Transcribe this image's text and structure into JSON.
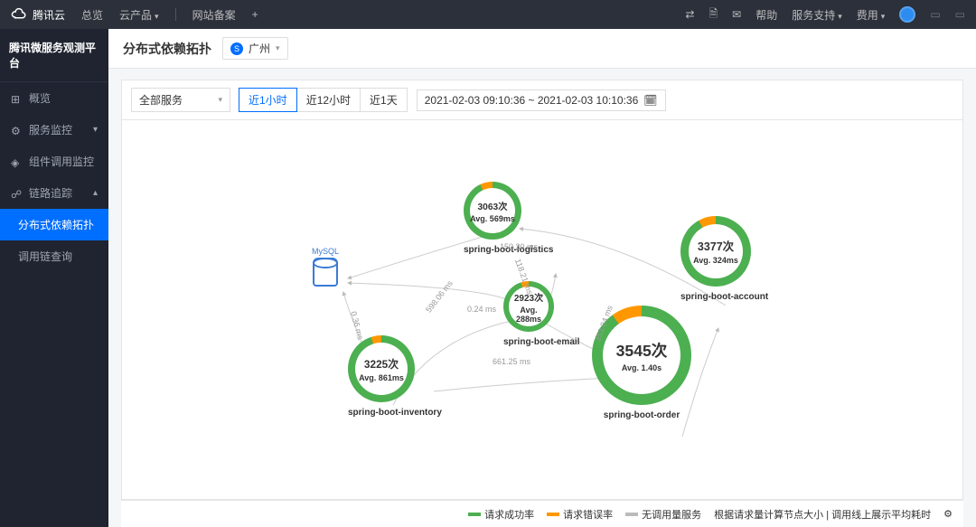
{
  "topbar": {
    "brand": "腾讯云",
    "nav": {
      "overview": "总览",
      "products": "云产品",
      "beian": "网站备案",
      "plus": "+"
    },
    "right": {
      "help": "帮助",
      "support": "服务支持",
      "fee": "费用"
    }
  },
  "sidebar": {
    "title": "腾讯微服务观测平台",
    "overview": "概览",
    "monitor": "服务监控",
    "component": "组件调用监控",
    "trace": "链路追踪",
    "topology": "分布式依赖拓扑",
    "chain": "调用链查询"
  },
  "page": {
    "title": "分布式依赖拓扑",
    "region": "广州"
  },
  "toolbar": {
    "service_filter": "全部服务",
    "range_1h": "近1小时",
    "range_12h": "近12小时",
    "range_1d": "近1天",
    "datetime": "2021-02-03 09:10:36 ~ 2021-02-03 10:10:36"
  },
  "nodes": {
    "mysql": {
      "label": "MySQL"
    },
    "logistics": {
      "count": "3063次",
      "avg": "Avg. 569ms",
      "label": "spring-boot-logistics",
      "size": 64,
      "success": 0.93
    },
    "email": {
      "count": "2923次",
      "avg": "Avg. 288ms",
      "label": "spring-boot-email",
      "size": 56,
      "success": 0.95
    },
    "account": {
      "count": "3377次",
      "avg": "Avg. 324ms",
      "label": "spring-boot-account",
      "size": 78,
      "success": 0.92
    },
    "inventory": {
      "count": "3225次",
      "avg": "Avg. 861ms",
      "label": "spring-boot-inventory",
      "size": 74,
      "success": 0.95
    },
    "order": {
      "count": "3545次",
      "avg": "Avg. 1.40s",
      "label": "spring-boot-order",
      "size": 110,
      "success": 0.9
    }
  },
  "edges": {
    "e1": "150.30 ms",
    "e2": "118.21 ms",
    "e3": "0.24 ms",
    "e4": "598.06 ms",
    "e5": "0.36 ms",
    "e6": "661.25 ms",
    "e7": "353.04 ms"
  },
  "legend": {
    "success": "请求成功率",
    "error": "请求错误率",
    "nocall": "无调用量服务",
    "note": "根据请求量计算节点大小 | 调用线上展示平均耗时"
  }
}
